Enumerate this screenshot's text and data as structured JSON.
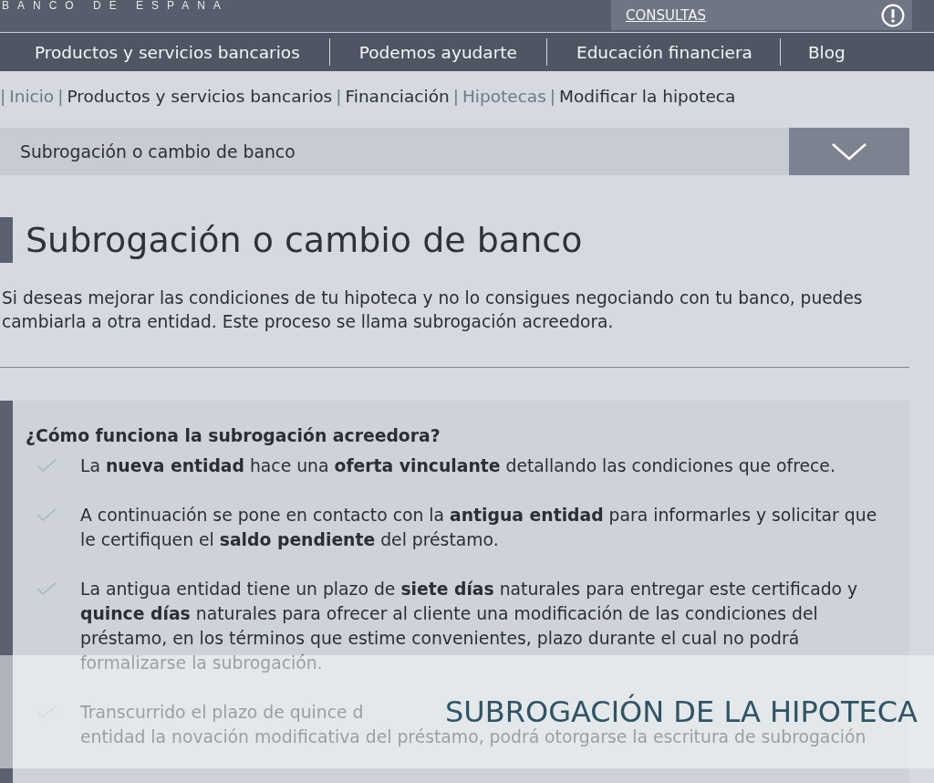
{
  "header": {
    "brand": "BANCO DE ESPAÑA",
    "consultas": "CONSULTAS"
  },
  "nav": [
    "Productos y servicios bancarios",
    "Podemos ayudarte",
    "Educación financiera",
    "Blog"
  ],
  "breadcrumb": [
    {
      "separator": "|",
      "label": "Inicio",
      "kind": "link"
    },
    {
      "separator": "|",
      "label": "Productos y servicios bancarios",
      "kind": "text"
    },
    {
      "separator": "|",
      "label": "Financiación",
      "kind": "text"
    },
    {
      "separator": "|",
      "label": "Hipotecas",
      "kind": "link"
    },
    {
      "separator": "|",
      "label": "Modificar la hipoteca",
      "kind": "text"
    }
  ],
  "dropdown": {
    "value": "Subrogación o cambio de banco"
  },
  "title": "Subrogación o cambio de banco",
  "intro": "Si deseas mejorar las condiciones de tu hipoteca y no lo consigues negociando con tu banco, puedes cambiarla a otra entidad. Este proceso se llama subrogación acreedora.",
  "box": {
    "heading": "¿Cómo funciona la subrogación acreedora?",
    "items": [
      {
        "text": "La **nueva entidad** hace una **oferta vinculante** detallando las condiciones que ofrece."
      },
      {
        "text": "A continuación se pone en contacto con la **antigua entidad** para informarles y solicitar que le certifiquen el **saldo pendiente** del préstamo."
      },
      {
        "text": "La antigua entidad tiene un plazo de **siete días** naturales para entregar este certificado y **quince días** naturales para ofrecer al cliente una modificación de las condiciones del préstamo, en los términos que estime convenientes, plazo durante el cual no podrá formalizarse la subrogación."
      },
      {
        "lines": [
          "Transcurrido el plazo de quince d",
          "entidad la novación modificativa del préstamo, podrá otorgarse la escritura de subrogación"
        ]
      }
    ]
  },
  "banner": {
    "title": "SUBROGACIÓN DE LA HIPOTECA"
  }
}
